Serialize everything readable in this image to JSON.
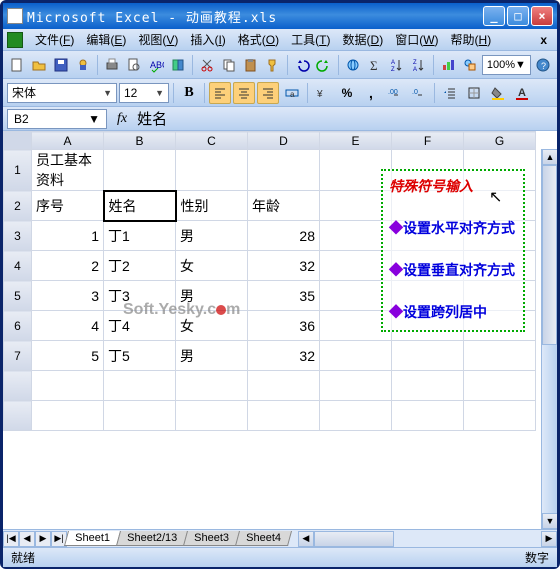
{
  "titlebar": {
    "text": "Microsoft Excel - 动画教程.xls"
  },
  "menubar": {
    "items": [
      {
        "label": "文件",
        "hot": "F"
      },
      {
        "label": "编辑",
        "hot": "E"
      },
      {
        "label": "视图",
        "hot": "V"
      },
      {
        "label": "插入",
        "hot": "I"
      },
      {
        "label": "格式",
        "hot": "O"
      },
      {
        "label": "工具",
        "hot": "T"
      },
      {
        "label": "数据",
        "hot": "D"
      },
      {
        "label": "窗口",
        "hot": "W"
      },
      {
        "label": "帮助",
        "hot": "H"
      }
    ],
    "close_x": "x"
  },
  "toolbar": {
    "zoom": "100%"
  },
  "formatbar": {
    "font": "宋体",
    "size": "12"
  },
  "formulabar": {
    "cell_ref": "B2",
    "fx": "fx",
    "content": "姓名"
  },
  "columns": [
    "A",
    "B",
    "C",
    "D",
    "E",
    "F",
    "G"
  ],
  "row_headers": [
    "1",
    "2",
    "3",
    "4",
    "5",
    "6",
    "7",
    "",
    ""
  ],
  "cells": {
    "A1": "员工基本资料",
    "A2": "序号",
    "B2": "姓名",
    "C2": "性别",
    "D2": "年龄",
    "A3": "1",
    "B3": "丁1",
    "C3": "男",
    "D3": "28",
    "A4": "2",
    "B4": "丁2",
    "C4": "女",
    "D4": "32",
    "A5": "3",
    "B5": "丁3",
    "C5": "男",
    "D5": "35",
    "A6": "4",
    "B6": "丁4",
    "C6": "女",
    "D6": "36",
    "A7": "5",
    "B7": "丁5",
    "C7": "男",
    "D7": "32"
  },
  "floating": {
    "title": "特殊符号输入",
    "items": [
      "设置水平对齐方式",
      "设置垂直对齐方式",
      "设置跨列居中"
    ],
    "bullet": "◆"
  },
  "watermark": {
    "part1": "Soft.Yesky.c",
    "part3": "m"
  },
  "tabs": [
    "Sheet1",
    "Sheet2/13",
    "Sheet3",
    "Sheet4"
  ],
  "statusbar": {
    "left": "就绪",
    "right": "数字"
  }
}
